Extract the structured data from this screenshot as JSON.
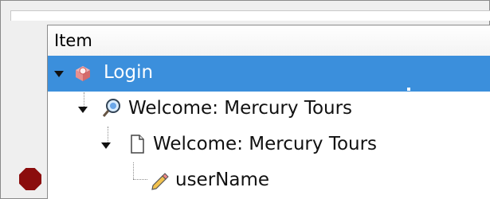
{
  "tree": {
    "header": "Item",
    "rows": [
      {
        "label": "Login",
        "icon": "gear-cube-icon",
        "selected": true
      },
      {
        "label": "Welcome: Mercury Tours",
        "icon": "browser-search-icon",
        "selected": false
      },
      {
        "label": "Welcome: Mercury Tours",
        "icon": "page-icon",
        "selected": false
      },
      {
        "label": "userName",
        "icon": "pencil-icon",
        "selected": false
      }
    ]
  },
  "colors": {
    "selection": "#3b8fdc",
    "breakpoint": "#8b0d0d",
    "text": "#111111"
  }
}
